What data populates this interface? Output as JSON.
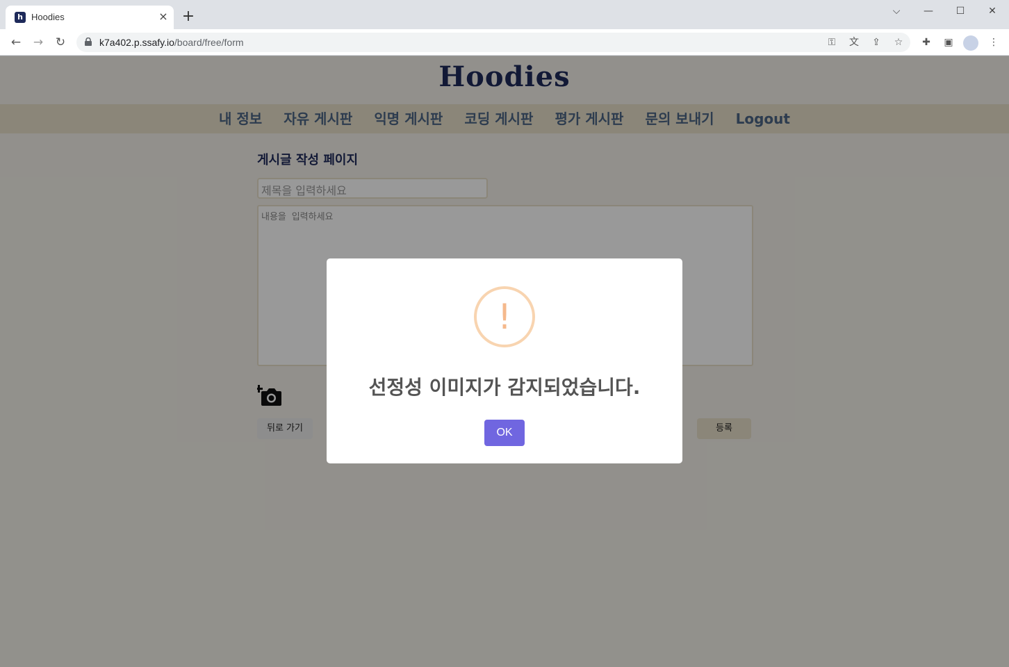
{
  "browser": {
    "tab_title": "Hoodies",
    "tab_favicon": "h",
    "url_host": "k7a402.p.ssafy.io",
    "url_path": "/board/free/form"
  },
  "site": {
    "logo": "Hoodies",
    "nav": [
      "내 정보",
      "자유 게시판",
      "익명 게시판",
      "코딩 게시판",
      "평가 게시판",
      "문의 보내기",
      "Logout"
    ]
  },
  "form": {
    "heading": "게시글 작성 페이지",
    "title_placeholder": "제목을 입력하세요",
    "body_placeholder": "내용을  입력하세요",
    "back_label": "뒤로 가기",
    "submit_label": "등록"
  },
  "dialog": {
    "icon_glyph": "!",
    "message": "선정성 이미지가 감지되었습니다.",
    "ok_label": "OK"
  },
  "colors": {
    "brand_navy": "#1e2a5a",
    "nav_bg": "#e8dfca",
    "ok_button": "#7066e0",
    "warning": "#f8bb86"
  }
}
